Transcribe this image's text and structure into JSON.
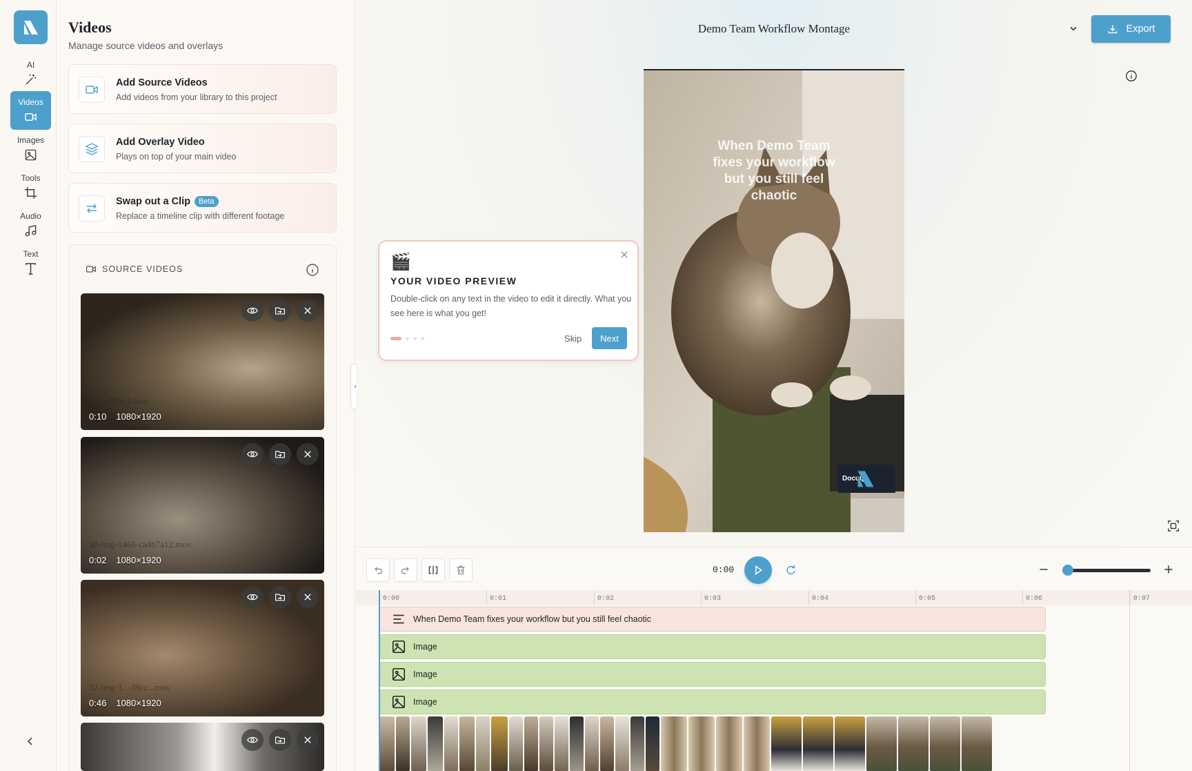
{
  "rail": {
    "items": [
      {
        "label": "AI",
        "icon": "magic-wand-icon"
      },
      {
        "label": "Videos",
        "icon": "video-camera-icon"
      },
      {
        "label": "Images",
        "icon": "image-icon"
      },
      {
        "label": "Tools",
        "icon": "crop-icon"
      },
      {
        "label": "Audio",
        "icon": "music-note-icon"
      },
      {
        "label": "Text",
        "icon": "text-icon"
      }
    ],
    "active": "Videos"
  },
  "panel": {
    "title": "Videos",
    "subtitle": "Manage source videos and overlays",
    "actions": [
      {
        "title": "Add Source Videos",
        "subtitle": "Add videos from your library to this project"
      },
      {
        "title": "Add Overlay Video",
        "subtitle": "Plays on top of your main video"
      },
      {
        "title": "Swap out a Clip",
        "badge": "Beta",
        "subtitle": "Replace a timeline clip with different footage"
      }
    ],
    "source_header": "SOURCE VIDEOS",
    "videos": [
      {
        "name": "...-...-9bbe3.mov",
        "duration": "0:10",
        "resolution": "1080×1920"
      },
      {
        "name": "30-img-1466-ca4b7a12.mov",
        "duration": "0:02",
        "resolution": "1080×1920"
      },
      {
        "name": "32-img-1...-f8cc...mov",
        "duration": "0:46",
        "resolution": "1080×1920"
      }
    ]
  },
  "header": {
    "project_title": "Demo Team Workflow Montage",
    "export_label": "Export"
  },
  "preview": {
    "caption": "When Demo Team fixes your workflow but you still feel chaotic",
    "watermark": "DocuQ"
  },
  "tooltip": {
    "title": "YOUR VIDEO PREVIEW",
    "body": "Double-click on any text in the video to edit it directly. What you see here is what you get!",
    "skip": "Skip",
    "next": "Next",
    "step": 1,
    "steps": 4
  },
  "timeline": {
    "current_time": "0:00",
    "ticks": [
      "0:00",
      "0:01",
      "0:02",
      "0:03",
      "0:04",
      "0:05",
      "0:06",
      "0:07"
    ],
    "tracks": [
      {
        "type": "text",
        "label": "When Demo Team fixes your workflow but you still feel chaotic"
      },
      {
        "type": "image",
        "label": "Image"
      },
      {
        "type": "image",
        "label": "Image"
      },
      {
        "type": "image",
        "label": "Image"
      }
    ]
  },
  "colors": {
    "accent": "#4da0cc",
    "text_track": "#f9e4de",
    "image_track": "#cde3b1"
  }
}
